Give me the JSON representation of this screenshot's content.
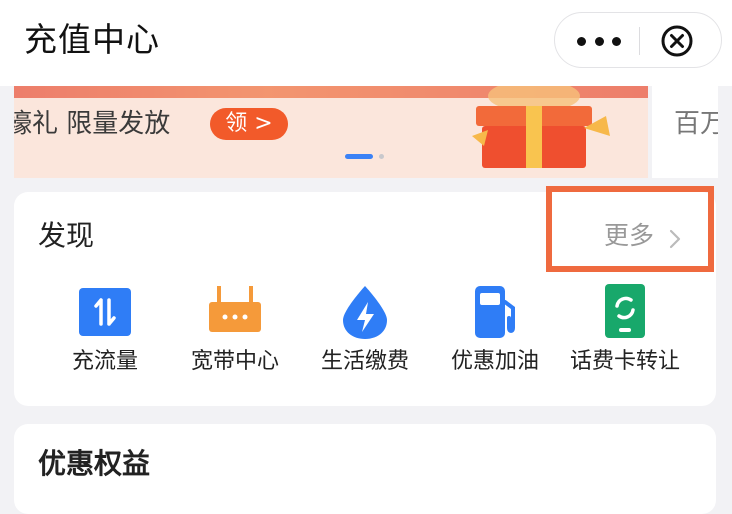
{
  "header": {
    "title": "充值中心"
  },
  "banner": {
    "text": "壕礼 限量发放",
    "button_label": "领 >",
    "side_text": "百万"
  },
  "discover": {
    "title": "发现",
    "more_label": "更多",
    "items": [
      {
        "label": "充流量",
        "icon": "data-transfer-icon",
        "color": "#2f7df6"
      },
      {
        "label": "宽带中心",
        "icon": "router-icon",
        "color": "#f59a3a"
      },
      {
        "label": "生活缴费",
        "icon": "lightning-drop-icon",
        "color": "#2f7df6"
      },
      {
        "label": "优惠加油",
        "icon": "fuel-pump-icon",
        "color": "#2f7df6"
      },
      {
        "label": "话费卡转让",
        "icon": "phone-card-icon",
        "color": "#18a86b"
      }
    ]
  },
  "benefits": {
    "title": "优惠权益"
  },
  "colors": {
    "accent": "#f25a2a",
    "highlight_box": "#ef6a3f"
  }
}
